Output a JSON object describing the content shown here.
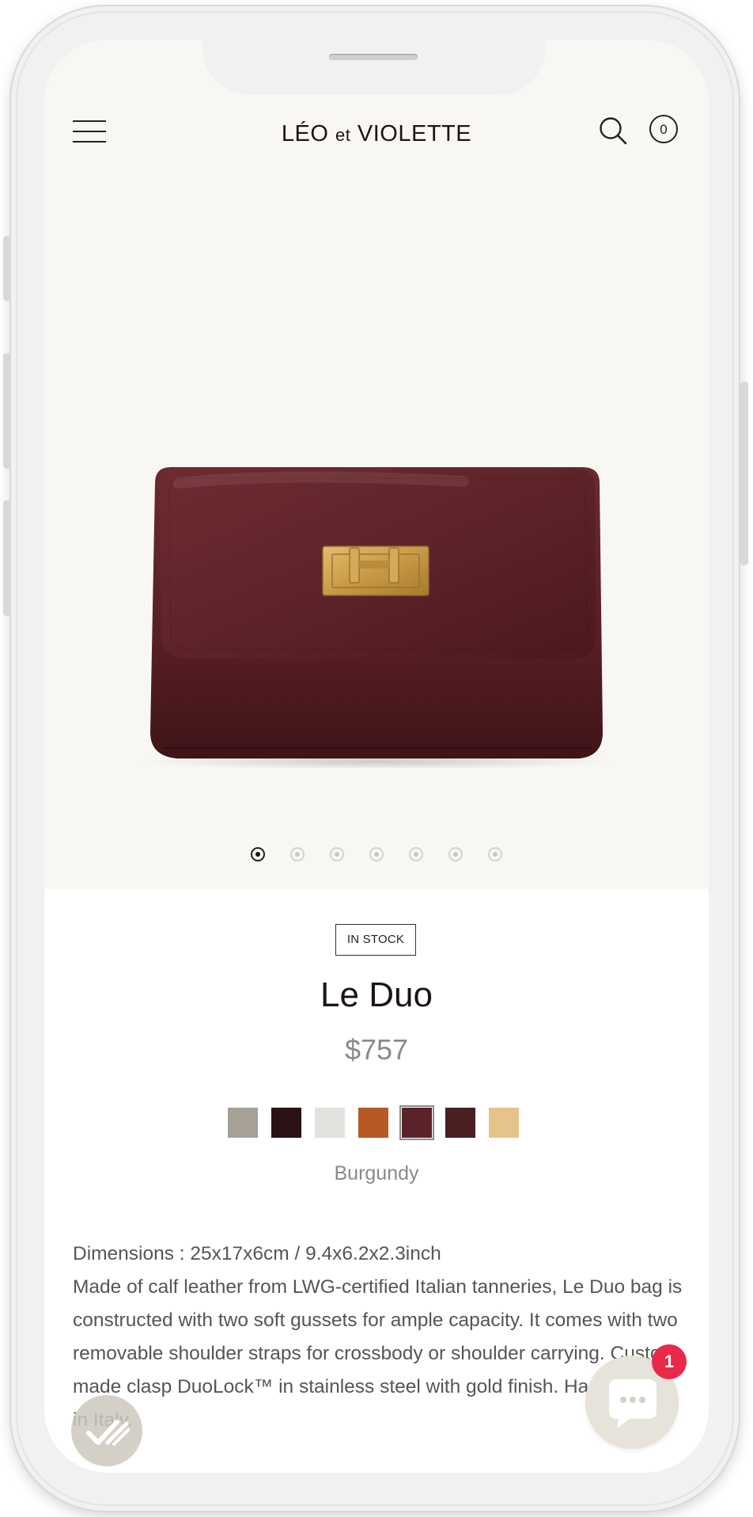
{
  "header": {
    "logo_main": "LÉO",
    "logo_small": "et",
    "logo_end": "VIOLETTE",
    "cart_count": "0",
    "icons": [
      "menu-icon",
      "search-icon",
      "cart-icon"
    ]
  },
  "gallery": {
    "image_count": 7,
    "active_index": 0
  },
  "product": {
    "stock_badge": "IN STOCK",
    "name": "Le Duo",
    "price": "$757",
    "selected_color": "Burgundy",
    "swatches": [
      {
        "name": "taupe",
        "hex": "#a6a097"
      },
      {
        "name": "dark-brown",
        "hex": "#2b1214"
      },
      {
        "name": "light-grey",
        "hex": "#e4e2de"
      },
      {
        "name": "cognac",
        "hex": "#b65a24"
      },
      {
        "name": "burgundy",
        "hex": "#5a2329",
        "selected": true
      },
      {
        "name": "chocolate",
        "hex": "#4a1f22"
      },
      {
        "name": "sand",
        "hex": "#e6c389"
      }
    ],
    "description": {
      "dimensions": "Dimensions : 25x17x6cm / 9.4x6.2x2.3inch",
      "body": "Made of calf leather from LWG-certified Italian tanneries, Le Duo bag is constructed with two soft gussets for ample capacity. It comes with two removable shoulder straps for crossbody or shoulder carrying. Custom-made clasp DuoLock™ in stainless steel with gold finish. Handcrafted in Italy."
    }
  },
  "chat": {
    "unread_count": "1"
  },
  "colors": {
    "background": "#f8f7f3",
    "text": "#1c1414",
    "accent_badge": "#e8294a"
  }
}
